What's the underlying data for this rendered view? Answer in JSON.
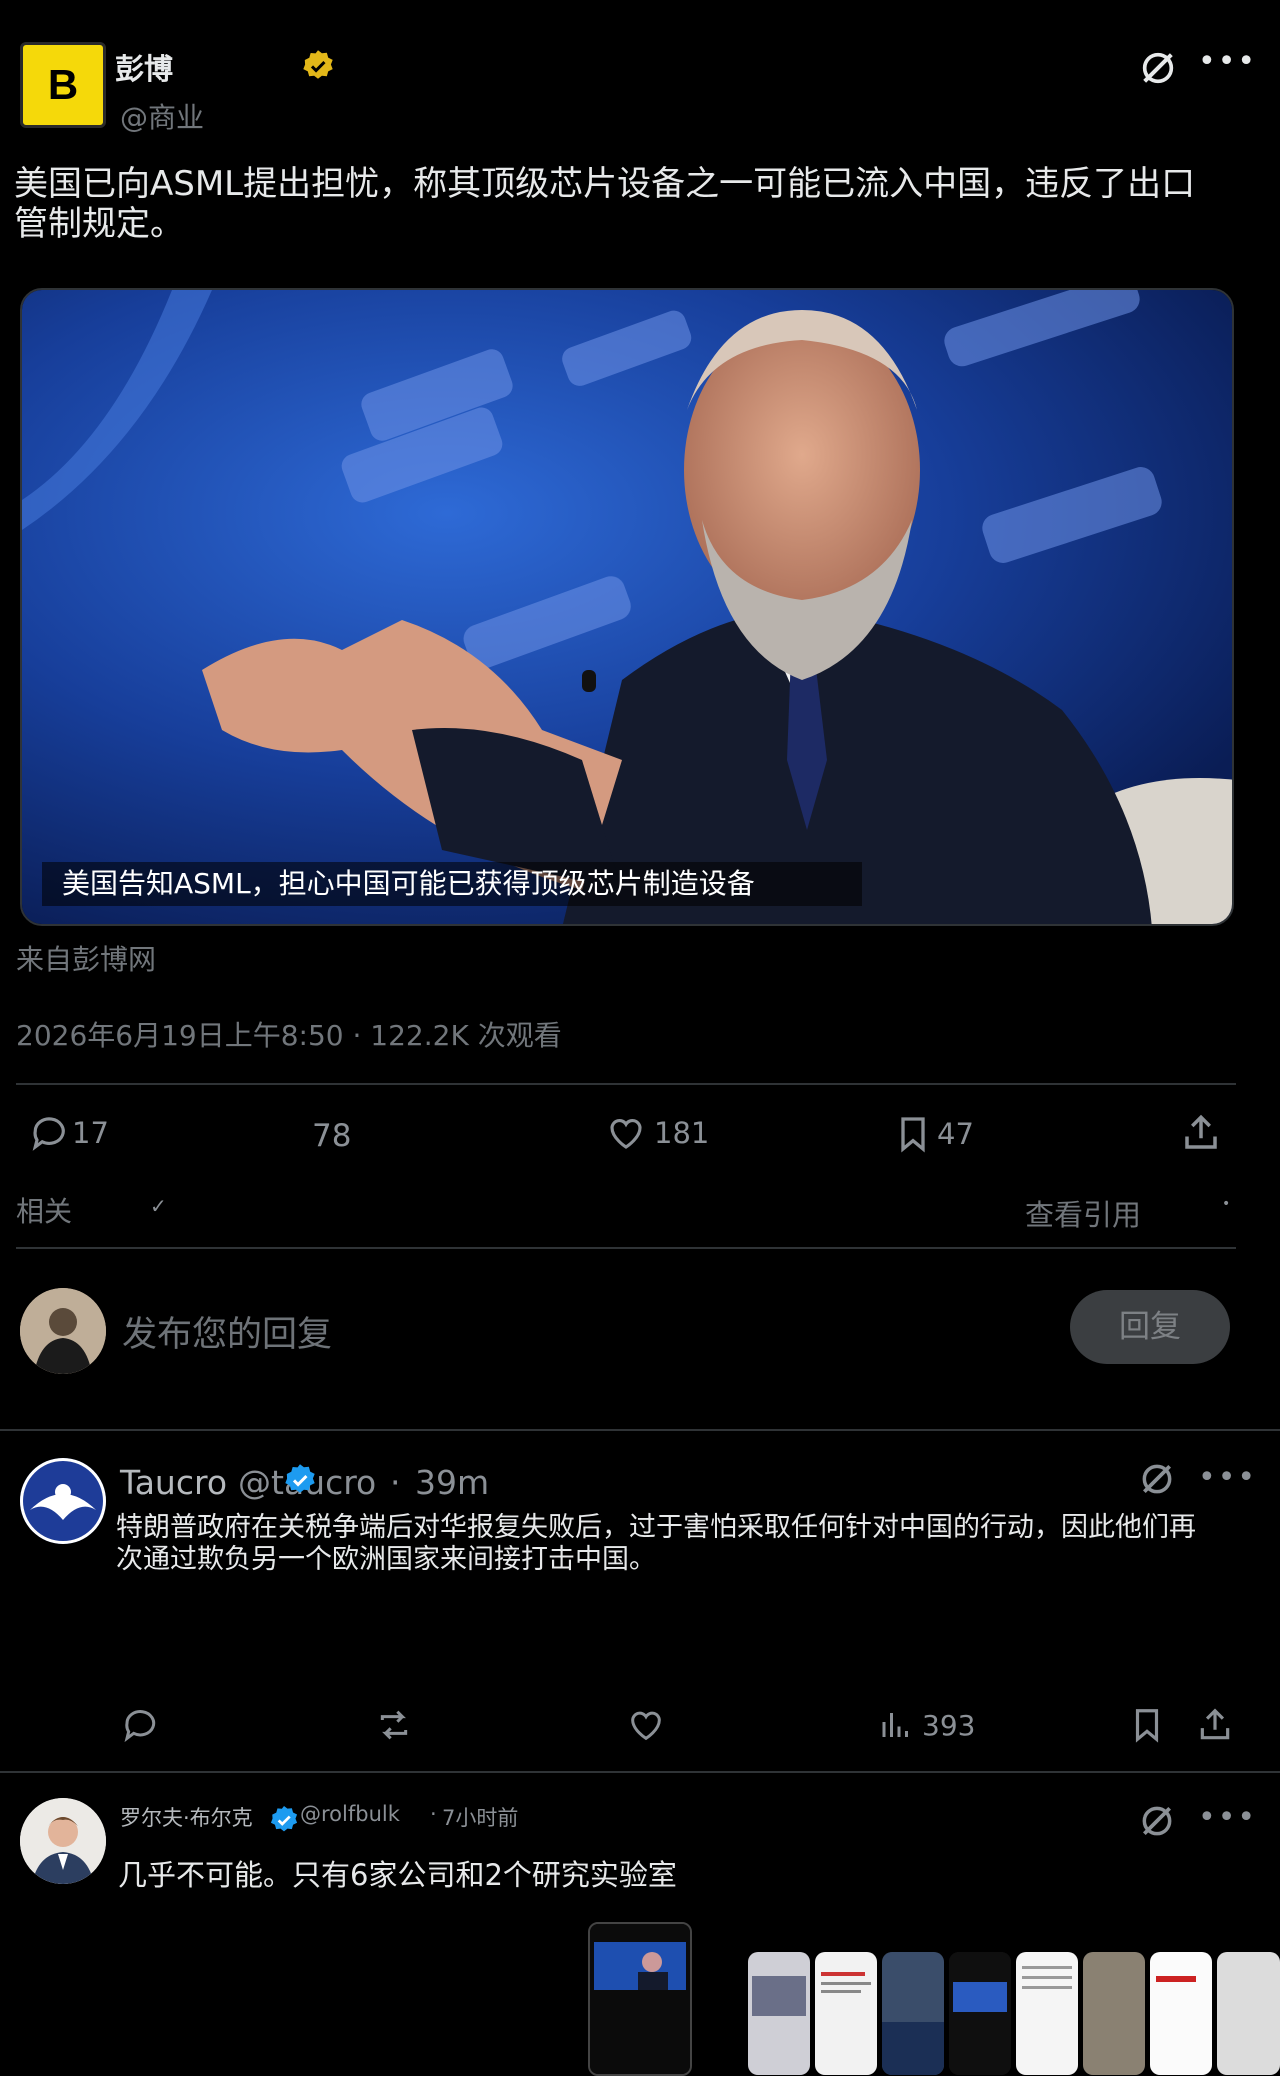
{
  "post": {
    "avatar_letter": "B",
    "author_name": "彭博",
    "handle": "@商业",
    "text": "美国已向ASML提出担忧，称其顶级芯片设备之一可能已流入中国，违反了出口管制规定。",
    "image_caption": "美国告知ASML，担心中国可能已获得顶级芯片制造设备",
    "source": "来自彭博网",
    "meta": "2026年6月19日上午8:50 · 122.2K 次观看",
    "stats": {
      "replies": "17",
      "reposts": "78",
      "likes": "181",
      "bookmarks": "47"
    },
    "related_label": "相关",
    "view_quotes_label": "查看引用",
    "more_icon": "more-dots-icon",
    "grok_icon": "grok-icon"
  },
  "composer": {
    "placeholder": "发布您的回复",
    "reply_button": "回复"
  },
  "replies": [
    {
      "name": "Taucro",
      "handle": "@taucro",
      "time": "39m",
      "text": "特朗普政府在关税争端后对华报复失败后，过于害怕采取任何针对中国的行动，因此他们再次通过欺负另一个欧洲国家来间接打击中国。",
      "views": "393"
    },
    {
      "name": "罗尔夫·布尔克",
      "handle": "@rolfbulk",
      "time": "7小时前",
      "text": "几乎不可能。只有6家公司和2个研究实验室"
    }
  ],
  "colors": {
    "background": "#000000",
    "text": "#e7e9ea",
    "muted": "#71767b",
    "verified": "#1d9bf0",
    "gold_badge": "#e2b719",
    "bloomberg_yellow": "#f5d90a"
  }
}
